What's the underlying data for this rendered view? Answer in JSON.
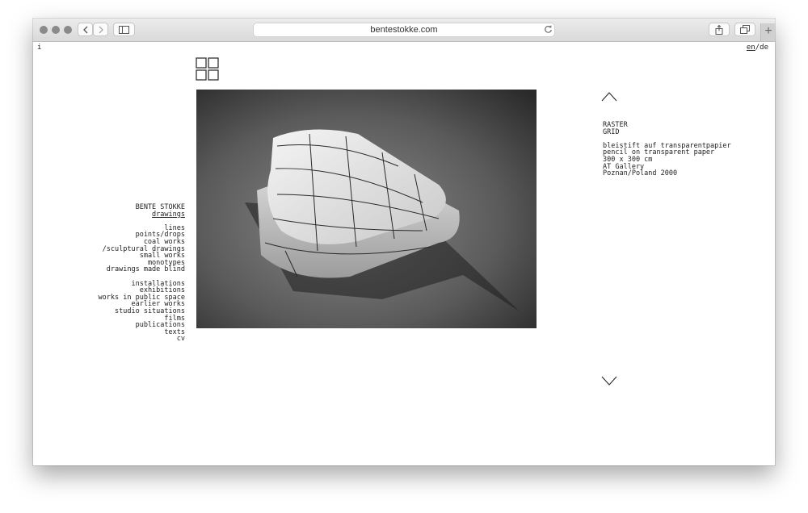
{
  "browser": {
    "url": "bentestokke.com"
  },
  "site": {
    "info_link": "i",
    "lang": {
      "en": "en",
      "sep": "/",
      "de": "de"
    }
  },
  "nav": {
    "artist": "BENTE STOKKE",
    "current": "drawings",
    "drawings_items": [
      "lines",
      "points/drops",
      "coal works",
      "/sculptural drawings",
      "small works",
      "monotypes",
      "drawings made blind"
    ],
    "sections": [
      "installations",
      "exhibitions",
      "works in public space",
      "earlier works",
      "studio situations",
      "films",
      "publications",
      "texts",
      "cv"
    ]
  },
  "work": {
    "title_de": "RASTER",
    "title_en": "GRID",
    "medium_de": "bleistift auf transparentpapier",
    "medium_en": "pencil on transparent paper",
    "size": "300 x 300 cm",
    "venue": "AT Gallery",
    "place": "Poznan/Poland 2000"
  },
  "icons": {
    "grid": "grid-view-icon",
    "prev": "chevron-up-icon",
    "next": "chevron-down-icon"
  }
}
